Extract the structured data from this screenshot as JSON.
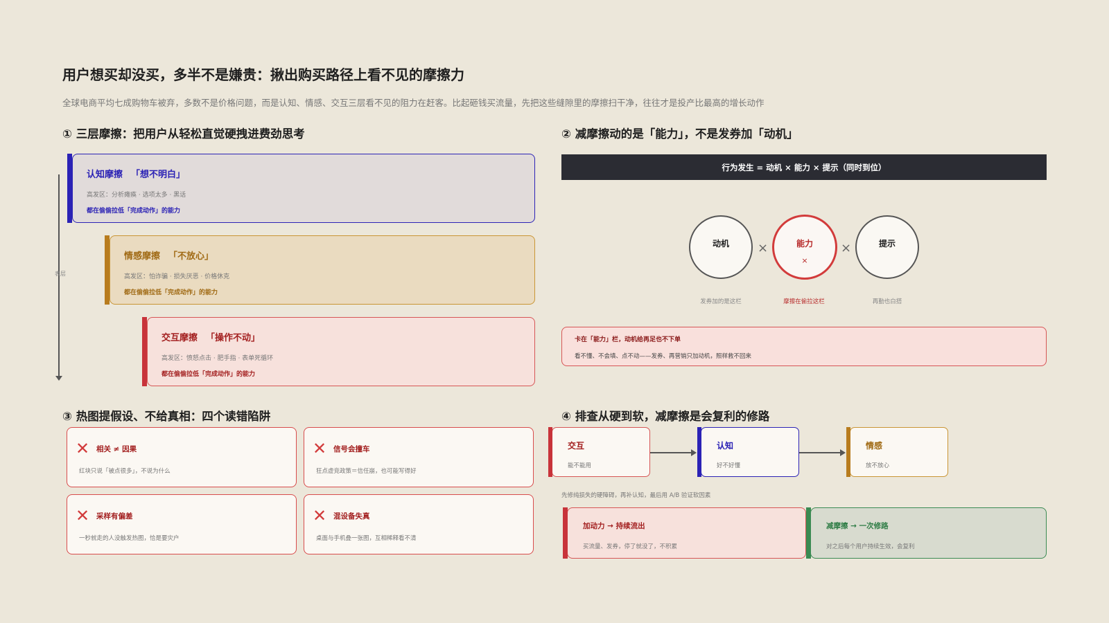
{
  "title": "用户想买却没买，多半不是嫌贵：揪出购买路径上看不见的摩擦力",
  "subtitle": "全球电商平均七成购物车被弃，多数不是价格问题，而是认知、情感、交互三层看不见的阻力在赶客。比起砸钱买流量，先把这些缝隙里的摩擦扫干净，往往才是投产比最高的增长动作",
  "colors": {
    "background": "#ece7da",
    "cognitive": "#2b22b5",
    "emotional": "#b87c1e",
    "interaction": "#c8333a",
    "green": "#3a8a52"
  },
  "section1": {
    "heading": "① 三层摩擦：把用户从轻松直觉硬拽进费劲思考",
    "axis_label": "表层",
    "layers": [
      {
        "title": "认知摩擦",
        "quote": "「想不明白」",
        "desc": "高发区：分析瘫痪 · 选项太多 · 黑话",
        "note": "都在偷偷拉低「完成动作」的能力"
      },
      {
        "title": "情感摩擦",
        "quote": "「不放心」",
        "desc": "高发区：怕诈骗 · 损失厌恶 · 价格休克",
        "note": "都在偷偷拉低「完成动作」的能力"
      },
      {
        "title": "交互摩擦",
        "quote": "「操作不动」",
        "desc": "高发区：愤怒点击 · 肥手指 · 表单死循环",
        "note": "都在偷偷拉低「完成动作」的能力"
      }
    ]
  },
  "section2": {
    "heading": "② 减摩擦动的是「能力」，不是发券加「动机」",
    "formula": "行为发生 = 动机 × 能力 × 提示（同时到位）",
    "times": "×",
    "circles": [
      {
        "label": "动机",
        "caption": "发券加的是这栏"
      },
      {
        "label": "能力",
        "mark": "×",
        "caption": "摩擦在偷拉这栏"
      },
      {
        "label": "提示",
        "caption": "再勤也白搭"
      }
    ],
    "callout": {
      "line1": "卡在「能力」栏，动机给再足也不下单",
      "line2": "看不懂、不会填、点不动——发券、再营销只加动机，照样救不回来"
    }
  },
  "section3": {
    "heading": "③ 热图提假设、不给真相：四个读错陷阱",
    "x_mark": "✕",
    "pitfalls": [
      {
        "title": "相关 ≠ 因果",
        "desc": "红块只说「被点很多」，不说为什么"
      },
      {
        "title": "信号会撞车",
        "desc": "狂点虚竞政策＝信任崩，也可能写得好"
      },
      {
        "title": "采样有偏差",
        "desc": "一秒就走的人没触发热图，恰是要灾户"
      },
      {
        "title": "混设备失真",
        "desc": "桌面与手机叠一张图，互相稀释看不清"
      }
    ]
  },
  "section4": {
    "heading": "④ 排查从硬到软，减摩擦是会复利的修路",
    "steps": [
      {
        "title": "交互",
        "desc": "能不能用"
      },
      {
        "title": "认知",
        "desc": "好不好懂"
      },
      {
        "title": "情感",
        "desc": "放不放心"
      }
    ],
    "note": "先修纯损失的硬障碍，再补认知，最后用 A/B 验证软因素",
    "compare": [
      {
        "title": "加动力 → 持续流出",
        "desc": "买流量、发券，停了就没了，不积累"
      },
      {
        "title": "减摩擦 → 一次修路",
        "desc": "对之后每个用户持续生效，会复利"
      }
    ]
  }
}
